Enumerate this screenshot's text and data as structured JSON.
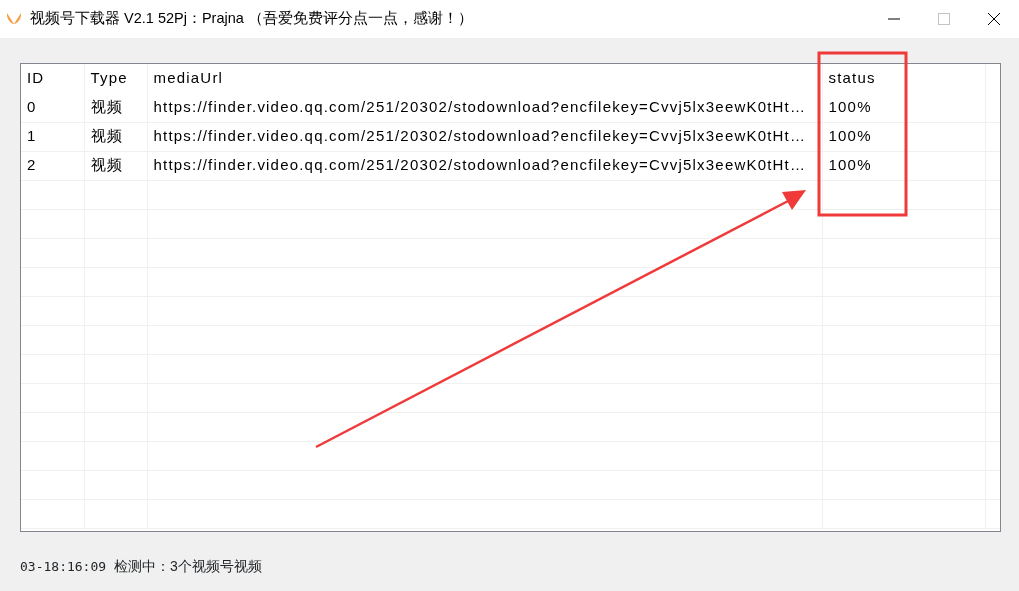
{
  "window": {
    "title": "视频号下载器 V2.1 52Pj：Prajna （吾爱免费评分点一点，感谢！）",
    "controls": [
      {
        "kind": "minimize",
        "disabled": false
      },
      {
        "kind": "maximize",
        "disabled": true
      },
      {
        "kind": "close",
        "disabled": false
      }
    ]
  },
  "table": {
    "columns": [
      "ID",
      "Type",
      "mediaUrl",
      "status"
    ],
    "rows": [
      {
        "id": "0",
        "type": "视频",
        "media_url": "https://finder.video.qq.com/251/20302/stodownload?encfilekey=Cvvj5lx3eewK0tHt…",
        "status": "100%"
      },
      {
        "id": "1",
        "type": "视频",
        "media_url": "https://finder.video.qq.com/251/20302/stodownload?encfilekey=Cvvj5lx3eewK0tHt…",
        "status": "100%"
      },
      {
        "id": "2",
        "type": "视频",
        "media_url": "https://finder.video.qq.com/251/20302/stodownload?encfilekey=Cvvj5lx3eewK0tHt…",
        "status": "100%"
      }
    ]
  },
  "status_bar": {
    "time": "03-18:16:09",
    "message": "检测中：3个视频号视频"
  }
}
